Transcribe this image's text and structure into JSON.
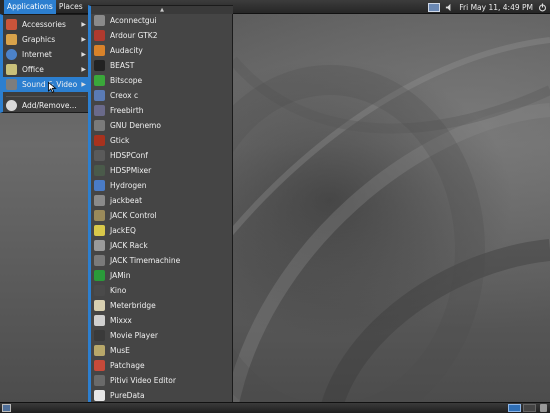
{
  "top_panel": {
    "applications_label": "Applications",
    "places_label": "Places",
    "clock": "Fri May 11,  4:49 PM"
  },
  "app_menu": {
    "items": [
      {
        "label": "Accessories",
        "icon": "accessories-icon",
        "color": "#c9543a"
      },
      {
        "label": "Graphics",
        "icon": "graphics-icon",
        "color": "#d8a24a"
      },
      {
        "label": "Internet",
        "icon": "internet-icon",
        "color": "#4c82c8"
      },
      {
        "label": "Office",
        "icon": "office-icon",
        "color": "#c9c07a"
      },
      {
        "label": "Sound & Video",
        "icon": "sound-video-icon",
        "color": "#7d7d7d"
      }
    ],
    "add_remove_label": "Add/Remove..."
  },
  "sound_video_menu": {
    "items": [
      {
        "label": "Aconnectgui",
        "icon": "aconnectgui-icon",
        "color": "#8a8a8a"
      },
      {
        "label": "Ardour GTK2",
        "icon": "ardour-icon",
        "color": "#b03a2e"
      },
      {
        "label": "Audacity",
        "icon": "audacity-icon",
        "color": "#d8822a"
      },
      {
        "label": "BEAST",
        "icon": "beast-icon",
        "color": "#222222"
      },
      {
        "label": "Bitscope",
        "icon": "bitscope-icon",
        "color": "#3aa83a"
      },
      {
        "label": "Creox c",
        "icon": "creox-icon",
        "color": "#5a7bb5"
      },
      {
        "label": "Freebirth",
        "icon": "freebirth-icon",
        "color": "#6a6a8a"
      },
      {
        "label": "GNU Denemo",
        "icon": "denemo-icon",
        "color": "#7a7a7a"
      },
      {
        "label": "Gtick",
        "icon": "gtick-icon",
        "color": "#a8321e"
      },
      {
        "label": "HDSPConf",
        "icon": "hdspconf-icon",
        "color": "#5a5a5a"
      },
      {
        "label": "HDSPMixer",
        "icon": "hdspmixer-icon",
        "color": "#4a5a4a"
      },
      {
        "label": "Hydrogen",
        "icon": "hydrogen-icon",
        "color": "#4a7cc8"
      },
      {
        "label": "jackbeat",
        "icon": "jackbeat-icon",
        "color": "#8a8a8a"
      },
      {
        "label": "JACK Control",
        "icon": "jack-control-icon",
        "color": "#9a8a5a"
      },
      {
        "label": "JackEQ",
        "icon": "jackeq-icon",
        "color": "#d8c84a"
      },
      {
        "label": "JACK Rack",
        "icon": "jack-rack-icon",
        "color": "#9a9a9a"
      },
      {
        "label": "JACK Timemachine",
        "icon": "jack-timemachine-icon",
        "color": "#7a7a7a"
      },
      {
        "label": "JAMin",
        "icon": "jamin-icon",
        "color": "#2a9a3a"
      },
      {
        "label": "Kino",
        "icon": "kino-icon",
        "color": "#4a4a4a"
      },
      {
        "label": "Meterbridge",
        "icon": "meterbridge-icon",
        "color": "#d8d0b0"
      },
      {
        "label": "Mixxx",
        "icon": "mixxx-icon",
        "color": "#d0d0d0"
      },
      {
        "label": "Movie Player",
        "icon": "movie-player-icon",
        "color": "#3a3a3a"
      },
      {
        "label": "MusE",
        "icon": "muse-icon",
        "color": "#b8a86a"
      },
      {
        "label": "Patchage",
        "icon": "patchage-icon",
        "color": "#c84a3a"
      },
      {
        "label": "Pitivi Video Editor",
        "icon": "pitivi-icon",
        "color": "#6a6a6a"
      },
      {
        "label": "PureData",
        "icon": "puredata-icon",
        "color": "#e8e8e8"
      }
    ]
  },
  "colors": {
    "accent": "#2c7fd0",
    "menu_bg": "#454545",
    "panel_bg": "#2e2e2e"
  }
}
